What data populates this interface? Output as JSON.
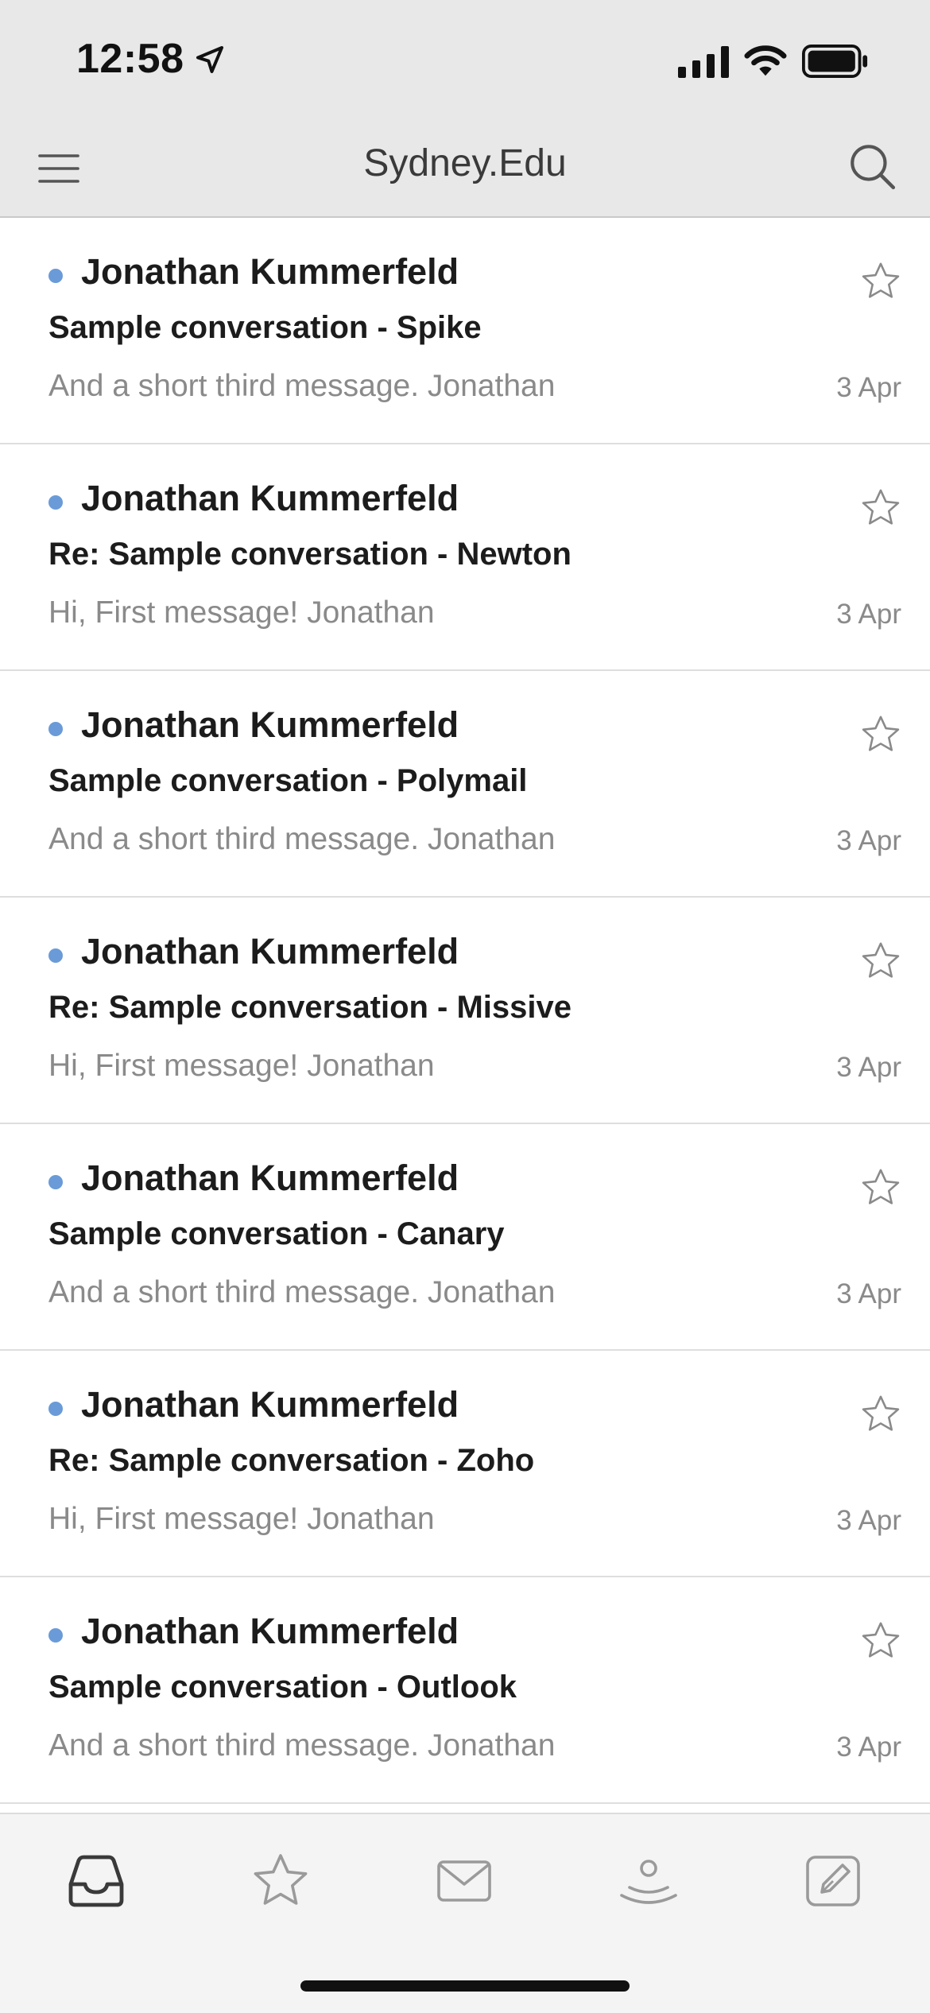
{
  "status_bar": {
    "time": "12:58"
  },
  "nav": {
    "title": "Sydney.Edu"
  },
  "messages": [
    {
      "sender": "Jonathan Kummerfeld",
      "subject": "Sample conversation - Spike",
      "preview": "And a short third message. Jonathan",
      "date": "3 Apr",
      "unread": true,
      "starred": false
    },
    {
      "sender": "Jonathan Kummerfeld",
      "subject": "Re: Sample conversation - Newton",
      "preview": "Hi, First message! Jonathan",
      "date": "3 Apr",
      "unread": true,
      "starred": false
    },
    {
      "sender": "Jonathan Kummerfeld",
      "subject": "Sample conversation - Polymail",
      "preview": "And a short third message. Jonathan",
      "date": "3 Apr",
      "unread": true,
      "starred": false
    },
    {
      "sender": "Jonathan Kummerfeld",
      "subject": "Re: Sample conversation - Missive",
      "preview": "Hi, First message! Jonathan",
      "date": "3 Apr",
      "unread": true,
      "starred": false
    },
    {
      "sender": "Jonathan Kummerfeld",
      "subject": "Sample conversation - Canary",
      "preview": "And a short third message. Jonathan",
      "date": "3 Apr",
      "unread": true,
      "starred": false
    },
    {
      "sender": "Jonathan Kummerfeld",
      "subject": "Re: Sample conversation - Zoho",
      "preview": "Hi, First message! Jonathan",
      "date": "3 Apr",
      "unread": true,
      "starred": false
    },
    {
      "sender": "Jonathan Kummerfeld",
      "subject": "Sample conversation - Outlook",
      "preview": "And a short third message. Jonathan",
      "date": "3 Apr",
      "unread": true,
      "starred": false
    }
  ],
  "tabs": [
    {
      "icon": "inbox-icon",
      "active": true
    },
    {
      "icon": "star-icon",
      "active": false
    },
    {
      "icon": "mail-icon",
      "active": false
    },
    {
      "icon": "contacts-icon",
      "active": false
    },
    {
      "icon": "compose-icon",
      "active": false
    }
  ],
  "colors": {
    "unread_dot": "#6a9bd8",
    "header_bg": "#e8e8e8",
    "tab_bar_bg": "#f4f4f4"
  }
}
